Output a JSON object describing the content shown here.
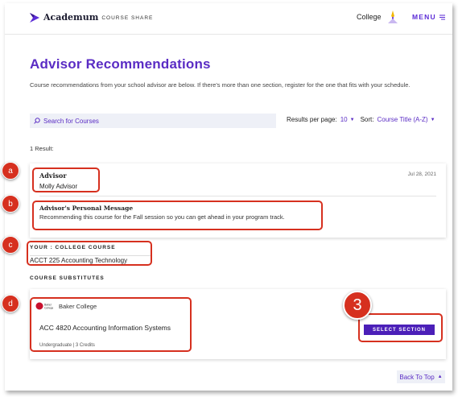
{
  "header": {
    "logo_name": "Academ",
    "logo_name_tail": "um",
    "logo_sub": "COURSE SHARE",
    "college_label": "College",
    "menu_label": "MENU",
    "icons": {
      "logo": "academum-logo-icon",
      "avatar": "college-avatar-icon",
      "menu": "hamburger-icon"
    }
  },
  "page": {
    "title": "Advisor Recommendations",
    "intro": "Course recommendations from your school advisor are below. If there's more than one section, register for the one that fits with your schedule."
  },
  "toolbar": {
    "search_placeholder": "Search for Courses",
    "results_per_page_label": "Results per page:",
    "results_per_page_value": "10",
    "sort_label": "Sort:",
    "sort_value": "Course Title (A-Z)"
  },
  "results_count": "1 Result:",
  "recommendation": {
    "advisor_label": "Advisor",
    "advisor_name": "Molly Advisor",
    "date": "Jul 28, 2021",
    "message_label": "Advisor's Personal Message",
    "message": "Recommending this course for the Fall session so you can get ahead in your program track."
  },
  "your_course": {
    "label": "YOUR : COLLEGE COURSE",
    "value": "ACCT 225 Accounting Technology"
  },
  "substitutes": {
    "label": "COURSE SUBSTITUTES",
    "items": [
      {
        "school_logo_text": "Baker College",
        "school": "Baker College",
        "title": "ACC 4820 Accounting Information Systems",
        "meta": "Undergraduate | 3 Credits",
        "button": "SELECT SECTION"
      }
    ]
  },
  "back_to_top": "Back To Top",
  "annotations": {
    "a": "a",
    "b": "b",
    "c": "c",
    "d": "d",
    "step": "3"
  },
  "colors": {
    "accent": "#5a2cc4",
    "button": "#4b1fb8",
    "callout": "#d6301f"
  }
}
